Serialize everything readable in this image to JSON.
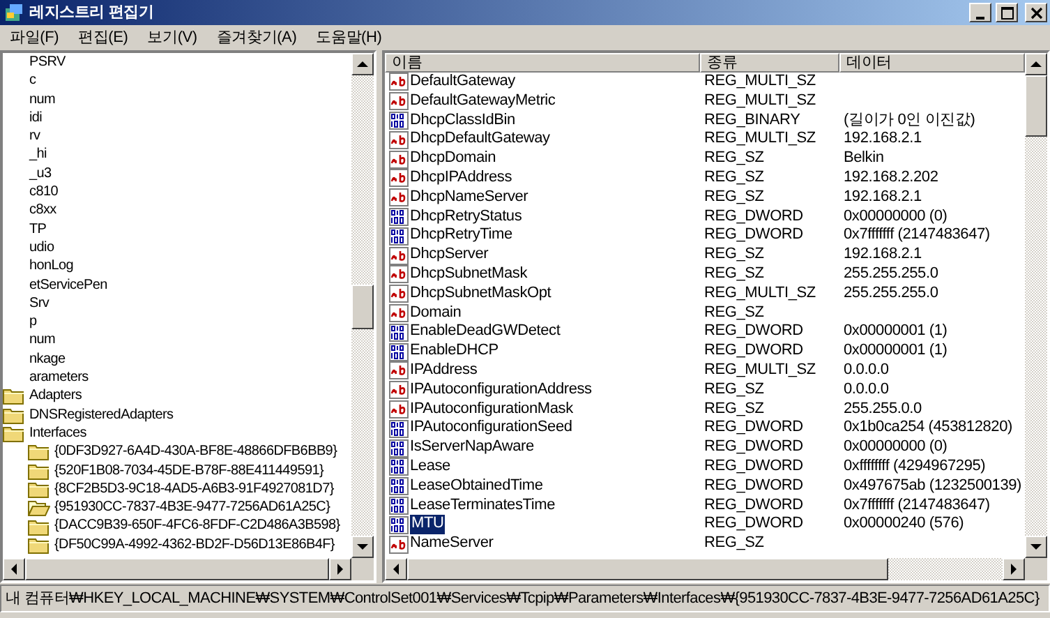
{
  "window": {
    "title": "레지스트리 편집기"
  },
  "menu": [
    "파일(F)",
    "편집(E)",
    "보기(V)",
    "즐겨찾기(A)",
    "도움말(H)"
  ],
  "tree": [
    {
      "label": "PSRV"
    },
    {
      "label": "c"
    },
    {
      "label": "num"
    },
    {
      "label": "idi"
    },
    {
      "label": "rv"
    },
    {
      "label": "_hi"
    },
    {
      "label": "_u3"
    },
    {
      "label": "c810"
    },
    {
      "label": "c8xx"
    },
    {
      "label": "TP"
    },
    {
      "label": "udio"
    },
    {
      "label": "honLog"
    },
    {
      "label": "etServicePen"
    },
    {
      "label": "Srv"
    },
    {
      "label": "p"
    },
    {
      "label": "num"
    },
    {
      "label": "nkage"
    },
    {
      "label": "arameters",
      "children": [
        {
          "label": "Adapters"
        },
        {
          "label": "DNSRegisteredAdapters"
        },
        {
          "label": "Interfaces",
          "children": [
            {
              "label": "{0DF3D927-6A4D-430A-BF8E-48866DFB6BB9}",
              "selected": false
            },
            {
              "label": "{520F1B08-7034-45DE-B78F-88E411449591}",
              "selected": false
            },
            {
              "label": "{8CF2B5D3-9C18-4AD5-A6B3-91F4927081D7}",
              "selected": false
            },
            {
              "label": "{951930CC-7837-4B3E-9477-7256AD61A25C}",
              "selected": true
            },
            {
              "label": "{DACC9B39-650F-4FC6-8FDF-C2D486A3B598}",
              "selected": false
            },
            {
              "label": "{DF50C99A-4992-4362-BD2F-D56D13E86B4F}",
              "selected": false
            }
          ]
        }
      ]
    }
  ],
  "table": {
    "columns": [
      "이름",
      "종류",
      "데이터"
    ],
    "rows": [
      {
        "kind": "string",
        "name": "DefaultGateway",
        "type": "REG_MULTI_SZ",
        "data": "",
        "selected": false
      },
      {
        "kind": "string",
        "name": "DefaultGatewayMetric",
        "type": "REG_MULTI_SZ",
        "data": "",
        "selected": false
      },
      {
        "kind": "binary",
        "name": "DhcpClassIdBin",
        "type": "REG_BINARY",
        "data": "(길이가 0인 이진값)",
        "selected": false
      },
      {
        "kind": "string",
        "name": "DhcpDefaultGateway",
        "type": "REG_MULTI_SZ",
        "data": "192.168.2.1",
        "selected": false
      },
      {
        "kind": "string",
        "name": "DhcpDomain",
        "type": "REG_SZ",
        "data": "Belkin",
        "selected": false
      },
      {
        "kind": "string",
        "name": "DhcpIPAddress",
        "type": "REG_SZ",
        "data": "192.168.2.202",
        "selected": false
      },
      {
        "kind": "string",
        "name": "DhcpNameServer",
        "type": "REG_SZ",
        "data": "192.168.2.1",
        "selected": false
      },
      {
        "kind": "binary",
        "name": "DhcpRetryStatus",
        "type": "REG_DWORD",
        "data": "0x00000000 (0)",
        "selected": false
      },
      {
        "kind": "binary",
        "name": "DhcpRetryTime",
        "type": "REG_DWORD",
        "data": "0x7fffffff (2147483647)",
        "selected": false
      },
      {
        "kind": "string",
        "name": "DhcpServer",
        "type": "REG_SZ",
        "data": "192.168.2.1",
        "selected": false
      },
      {
        "kind": "string",
        "name": "DhcpSubnetMask",
        "type": "REG_SZ",
        "data": "255.255.255.0",
        "selected": false
      },
      {
        "kind": "string",
        "name": "DhcpSubnetMaskOpt",
        "type": "REG_MULTI_SZ",
        "data": "255.255.255.0",
        "selected": false
      },
      {
        "kind": "string",
        "name": "Domain",
        "type": "REG_SZ",
        "data": "",
        "selected": false
      },
      {
        "kind": "binary",
        "name": "EnableDeadGWDetect",
        "type": "REG_DWORD",
        "data": "0x00000001 (1)",
        "selected": false
      },
      {
        "kind": "binary",
        "name": "EnableDHCP",
        "type": "REG_DWORD",
        "data": "0x00000001 (1)",
        "selected": false
      },
      {
        "kind": "string",
        "name": "IPAddress",
        "type": "REG_MULTI_SZ",
        "data": "0.0.0.0",
        "selected": false
      },
      {
        "kind": "string",
        "name": "IPAutoconfigurationAddress",
        "type": "REG_SZ",
        "data": "0.0.0.0",
        "selected": false
      },
      {
        "kind": "string",
        "name": "IPAutoconfigurationMask",
        "type": "REG_SZ",
        "data": "255.255.0.0",
        "selected": false
      },
      {
        "kind": "binary",
        "name": "IPAutoconfigurationSeed",
        "type": "REG_DWORD",
        "data": "0x1b0ca254 (453812820)",
        "selected": false
      },
      {
        "kind": "binary",
        "name": "IsServerNapAware",
        "type": "REG_DWORD",
        "data": "0x00000000 (0)",
        "selected": false
      },
      {
        "kind": "binary",
        "name": "Lease",
        "type": "REG_DWORD",
        "data": "0xffffffff (4294967295)",
        "selected": false
      },
      {
        "kind": "binary",
        "name": "LeaseObtainedTime",
        "type": "REG_DWORD",
        "data": "0x497675ab (1232500139)",
        "selected": false
      },
      {
        "kind": "binary",
        "name": "LeaseTerminatesTime",
        "type": "REG_DWORD",
        "data": "0x7fffffff (2147483647)",
        "selected": false
      },
      {
        "kind": "binary",
        "name": "MTU",
        "type": "REG_DWORD",
        "data": "0x00000240 (576)",
        "selected": true
      },
      {
        "kind": "string",
        "name": "NameServer",
        "type": "REG_SZ",
        "data": "",
        "selected": false
      }
    ]
  },
  "status_bar": "내 컴퓨터₩HKEY_LOCAL_MACHINE₩SYSTEM₩ControlSet001₩Services₩Tcpip₩Parameters₩Interfaces₩{951930CC-7837-4B3E-9477-7256AD61A25C}"
}
